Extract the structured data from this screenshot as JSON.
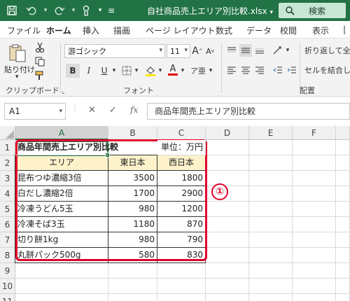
{
  "titlebar": {
    "filename": "自社商品売上エリア別比較.xlsx",
    "search_label": "検索",
    "colors": {
      "bg": "#217346"
    }
  },
  "ribbon_tabs": [
    "ファイル",
    "ホーム",
    "挿入",
    "描画",
    "ページ レイアウト",
    "数式",
    "データ",
    "校閲",
    "表示"
  ],
  "active_tab": "ホーム",
  "ribbon": {
    "paste_label": "貼り付け",
    "clipboard_label": "クリップボード",
    "font_name": "游ゴシック",
    "font_size": "11",
    "font_label": "フォント",
    "bold": "B",
    "italic": "I",
    "underline": "U",
    "grow_font": "A",
    "shrink_font": "A",
    "wrap_text_label": "折り返して全",
    "merge_label": "セルを結合し",
    "alignment_label": "配置",
    "font_color_glyph": "A"
  },
  "formula_bar": {
    "name_box": "A1",
    "cancel": "✕",
    "enter": "✓",
    "fx": "fx",
    "content": "商品年間売上エリア別比較"
  },
  "columns": [
    "A",
    "B",
    "C",
    "D",
    "E",
    "F"
  ],
  "rows": [
    "1",
    "2",
    "3",
    "4",
    "5",
    "6",
    "7",
    "8",
    "9",
    "10",
    "11"
  ],
  "sheet": {
    "title": "商品年間売上エリア別比較",
    "unit": "単位：万円",
    "headers": [
      "エリア",
      "東日本",
      "西日本"
    ],
    "data": [
      [
        "昆布つゆ濃縮3倍",
        "3500",
        "1800"
      ],
      [
        "白だし濃縮2倍",
        "1700",
        "2900"
      ],
      [
        "冷凍うどん5玉",
        "980",
        "1200"
      ],
      [
        "冷凍そば3玉",
        "1180",
        "870"
      ],
      [
        "切り餅1kg",
        "980",
        "790"
      ],
      [
        "丸餅パック500g",
        "580",
        "830"
      ]
    ]
  },
  "annotation": {
    "badge": "①",
    "color": "#e0002a"
  }
}
